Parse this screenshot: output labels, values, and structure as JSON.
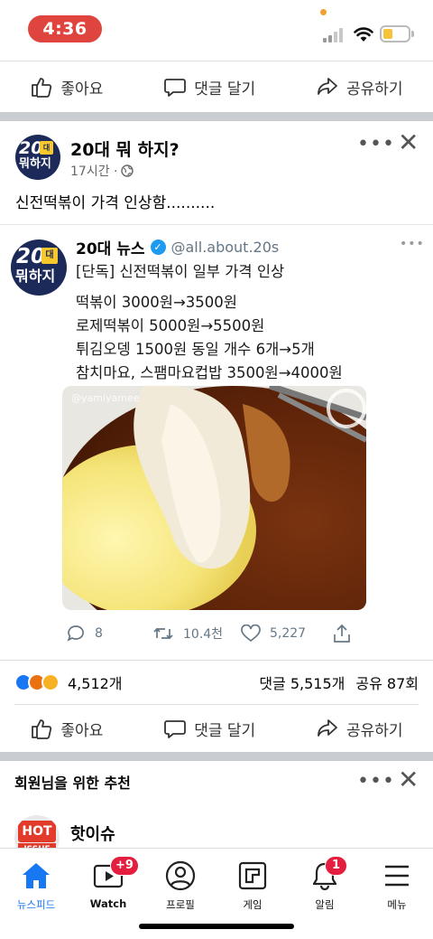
{
  "status_bar": {
    "time": "4:36"
  },
  "actions": {
    "like": "좋아요",
    "comment": "댓글 달기",
    "share": "공유하기"
  },
  "post": {
    "page_name": "20대 뭐 하지?",
    "avatar_text_top": "20",
    "avatar_text_small": "대",
    "avatar_text_bottom": "뭐하지",
    "time": "17시간 ·",
    "text": "신전떡볶이 가격 인상함..........",
    "tweet": {
      "name": "20대 뉴스",
      "handle": "@all.about.20s",
      "lines": [
        "[단독] 신전떡볶이 일부 가격 인상",
        "떡볶이 3000원→3500원",
        "로제떡볶이 5000원→5500원",
        "튀김오뎅 1500원 동일 개수 6개→5개",
        "참치마요, 스팸마요컵밥 3500원→4000원"
      ],
      "photo_watermark": "@yamiyamee",
      "stats": {
        "replies": "8",
        "retweets": "10.4천",
        "likes": "5,227"
      }
    },
    "reactions_count": "4,512개",
    "comments_count": "댓글 5,515개",
    "shares_count": "공유 87회"
  },
  "recommendation": {
    "title": "회원님을 위한 추천",
    "page_name": "핫이슈",
    "avatar_text_top": "HOT",
    "avatar_text_bottom": "ISSUE"
  },
  "tab_bar": {
    "tabs": [
      "뉴스피드",
      "Watch",
      "프로필",
      "게임",
      "알림",
      "메뉴"
    ],
    "watch_badge": "+9",
    "notif_badge": "1"
  },
  "colors": {
    "accent": "#1877f2",
    "badge": "#e41e3f",
    "time_pill": "#e0443e"
  }
}
